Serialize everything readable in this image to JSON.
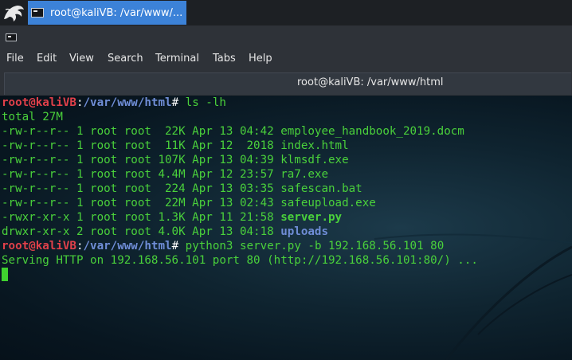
{
  "taskbar": {
    "active_window_label": "root@kaliVB: /var/www/..."
  },
  "window": {
    "tab_title": "root@kaliVB: /var/www/html"
  },
  "menu": [
    "File",
    "Edit",
    "View",
    "Search",
    "Terminal",
    "Tabs",
    "Help"
  ],
  "terminal": {
    "prompt_user_host": "root@kaliVB",
    "prompt_sep": ":",
    "prompt_path": "/var/www/html",
    "prompt_end": "# ",
    "command1": "ls -lh",
    "total": "total 27M",
    "listing": [
      {
        "meta": "-rw-r--r-- 1 root root  22K Apr 13 04:42 ",
        "name": "employee_handbook_2019.docm",
        "style": "plain"
      },
      {
        "meta": "-rw-r--r-- 1 root root  11K Apr 12  2018 ",
        "name": "index.html",
        "style": "plain"
      },
      {
        "meta": "-rw-r--r-- 1 root root 107K Apr 13 04:39 ",
        "name": "klmsdf.exe",
        "style": "plain"
      },
      {
        "meta": "-rw-r--r-- 1 root root 4.4M Apr 12 23:57 ",
        "name": "ra7.exe",
        "style": "plain"
      },
      {
        "meta": "-rw-r--r-- 1 root root  224 Apr 13 03:35 ",
        "name": "safescan.bat",
        "style": "plain"
      },
      {
        "meta": "-rw-r--r-- 1 root root  22M Apr 13 02:43 ",
        "name": "safeupload.exe",
        "style": "plain"
      },
      {
        "meta": "-rwxr-xr-x 1 root root 1.3K Apr 11 21:58 ",
        "name": "server.py",
        "style": "exec"
      },
      {
        "meta": "drwxr-xr-x 2 root root 4.0K Apr 13 04:18 ",
        "name": "uploads",
        "style": "dir"
      }
    ],
    "command2": "python3 server.py -b 192.168.56.101 80",
    "serving_line": "Serving HTTP on 192.168.56.101 port 80 (http://192.168.56.101:80/) ..."
  },
  "colors": {
    "prompt_user": "#e0404a",
    "prompt_path": "#6f8dd6",
    "text_green": "#4ad13b",
    "taskbar_active": "#3c82d8"
  }
}
